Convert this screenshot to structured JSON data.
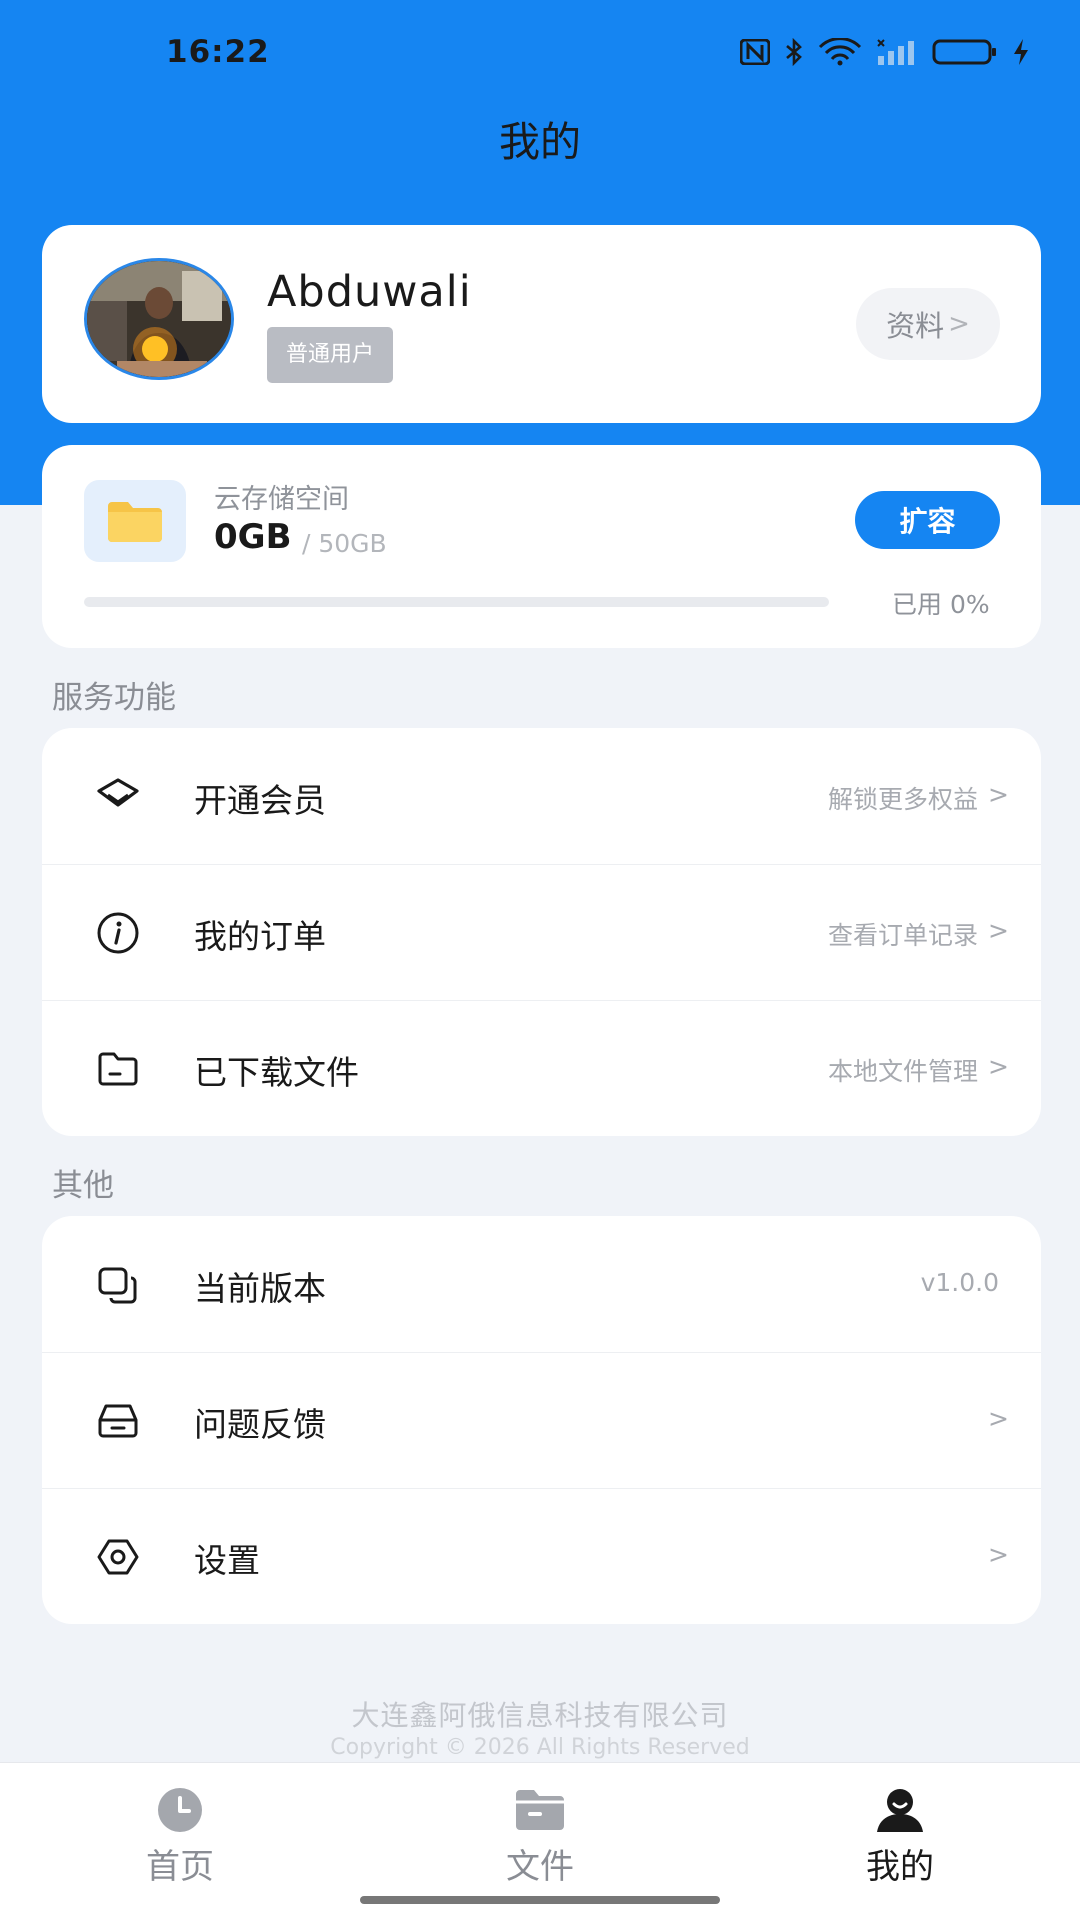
{
  "status_bar": {
    "time": "16:22"
  },
  "header": {
    "title": "我的"
  },
  "profile": {
    "username": "Abduwali",
    "badge": "普通用户",
    "profile_button": "资料",
    "chevron": ">"
  },
  "storage": {
    "label": "云存储空间",
    "used": "0GB",
    "total": "/ 50GB",
    "expand_button": "扩容",
    "usage_text": "已用 0%",
    "usage_fraction": 0.0
  },
  "services": {
    "title": "服务功能",
    "items": [
      {
        "label": "开通会员",
        "hint": "解锁更多权益",
        "chevron": ">",
        "icon": "diamond-icon"
      },
      {
        "label": "我的订单",
        "hint": "查看订单记录",
        "chevron": ">",
        "icon": "info-icon"
      },
      {
        "label": "已下载文件",
        "hint": "本地文件管理",
        "chevron": ">",
        "icon": "folder-icon"
      }
    ]
  },
  "others": {
    "title": "其他",
    "items": [
      {
        "label": "当前版本",
        "hint": "v1.0.0",
        "icon": "copy-icon"
      },
      {
        "label": "问题反馈",
        "chevron": ">",
        "icon": "inbox-icon"
      },
      {
        "label": "设置",
        "chevron": ">",
        "icon": "settings-icon"
      }
    ]
  },
  "footer": {
    "company": "大连鑫阿俄信息科技有限公司",
    "copyright": "Copyright © 2026 All Rights Reserved"
  },
  "tab_bar": {
    "tabs": [
      {
        "label": "首页",
        "icon": "clock-icon"
      },
      {
        "label": "文件",
        "icon": "folder-icon"
      },
      {
        "label": "我的",
        "icon": "user-icon",
        "active": true
      }
    ]
  },
  "colors": {
    "brand_blue": "#1585f2",
    "background": "#f0f3f8",
    "folder_yellow": "#f6c447"
  }
}
